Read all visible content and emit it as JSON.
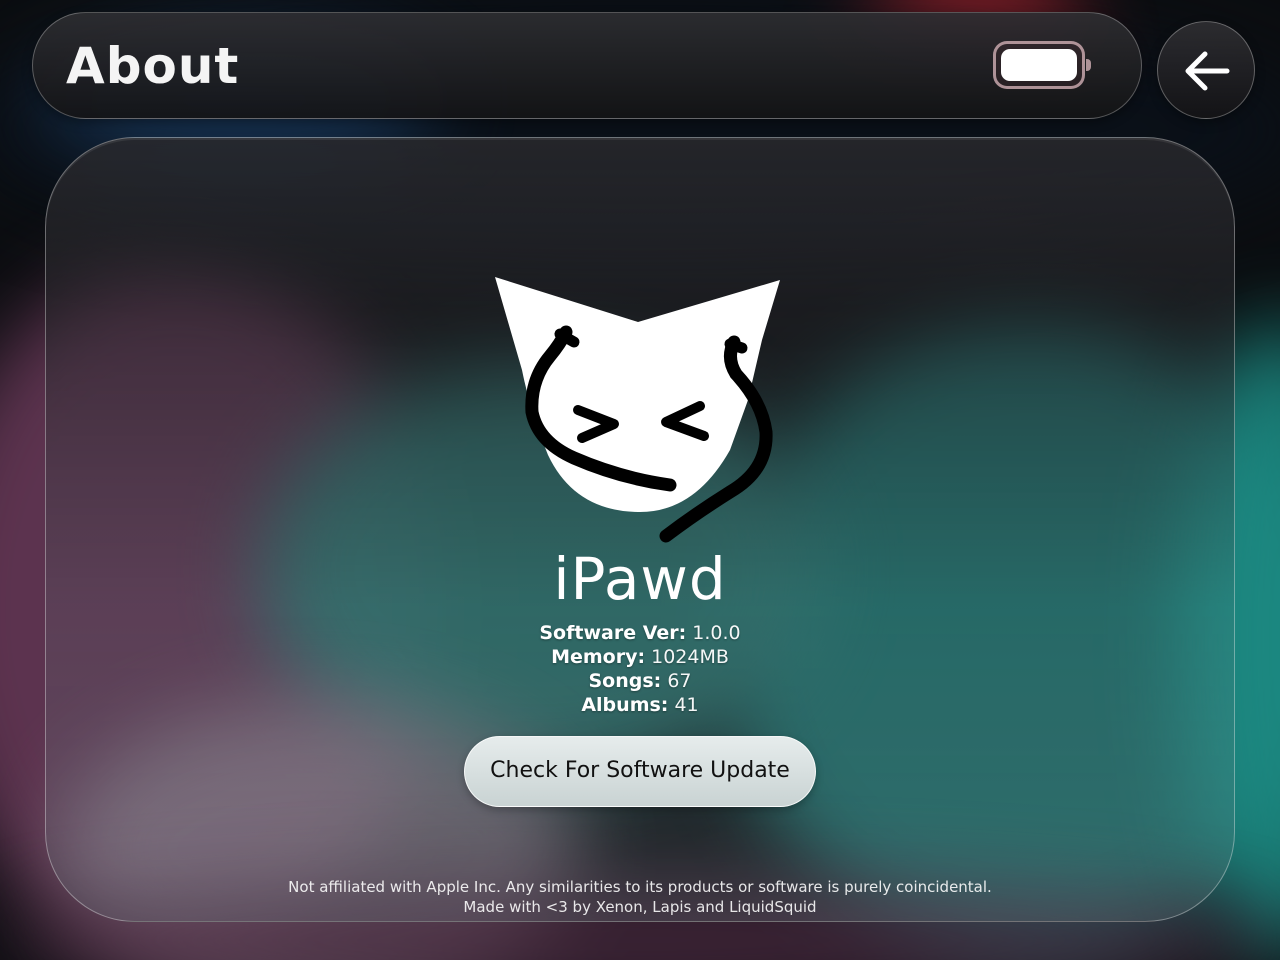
{
  "header": {
    "title": "About",
    "battery_icon": "battery-icon",
    "battery_level": 1.0
  },
  "back_button": {
    "icon": "arrow-left-icon"
  },
  "app": {
    "name": "iPawd",
    "logo_icon": "cat-face-logo"
  },
  "info": [
    {
      "label": "Software Ver:",
      "value": "1.0.0"
    },
    {
      "label": "Memory:",
      "value": "1024MB"
    },
    {
      "label": "Songs:",
      "value": "67"
    },
    {
      "label": "Albums:",
      "value": "41"
    }
  ],
  "update_button": {
    "label": "Check For Software Update"
  },
  "footer": {
    "disclaimer": "Not affiliated with Apple Inc. Any similarities to its products or software is purely coincidental.",
    "credits": "Made with <3 by Xenon, Lapis and LiquidSquid"
  },
  "colors": {
    "accent_red": "#c0242e",
    "teal": "#1d6b68",
    "header_bg": "#1e1e21"
  }
}
